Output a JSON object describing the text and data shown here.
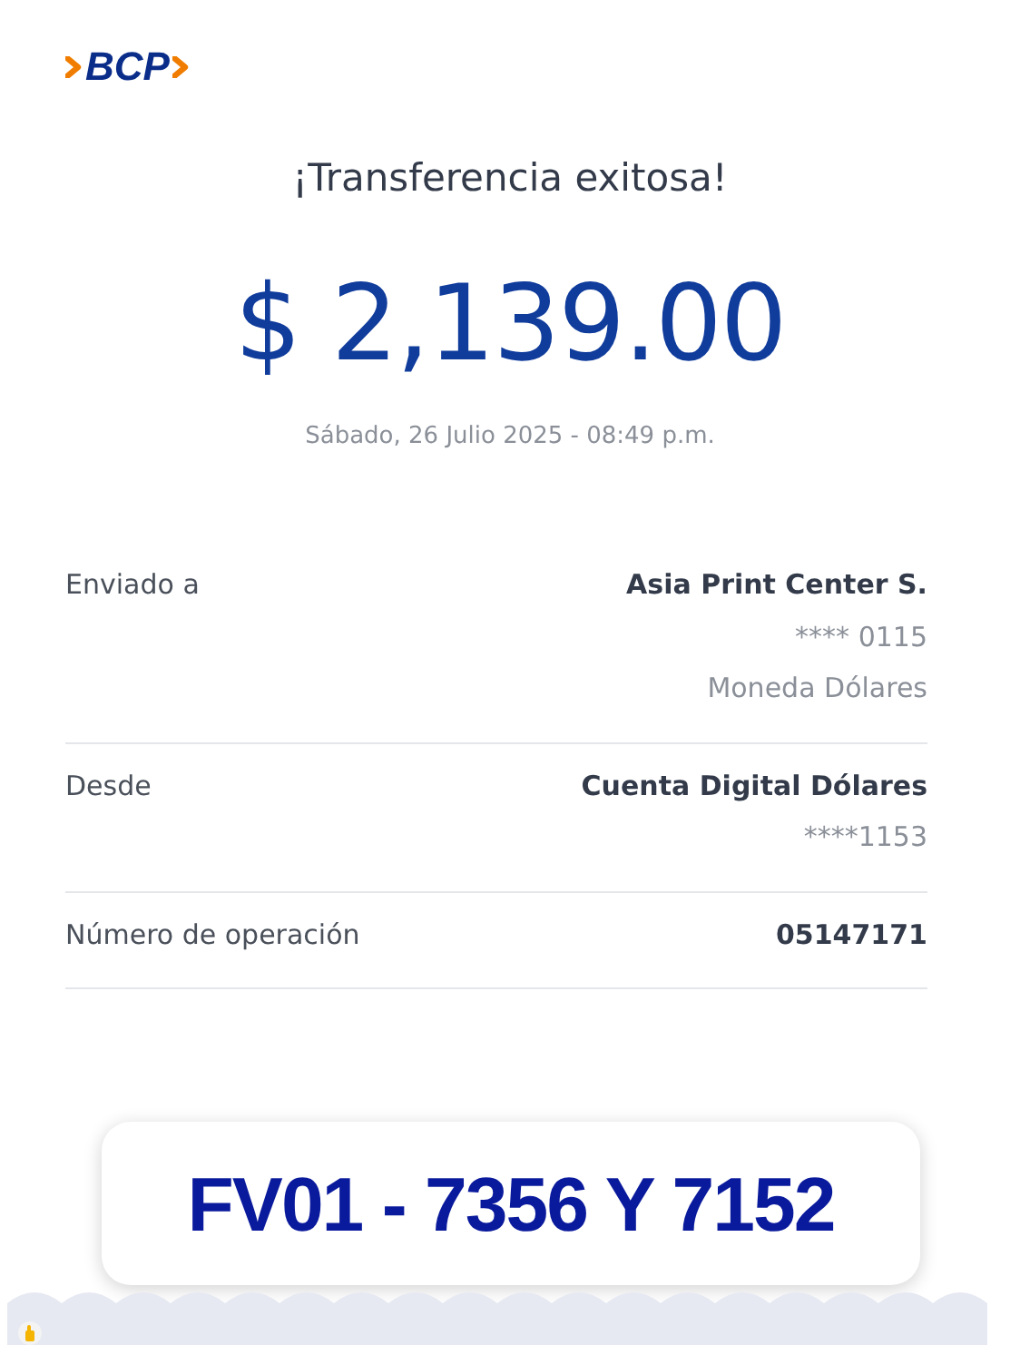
{
  "logo": {
    "text": "BCP"
  },
  "title": "¡Transferencia exitosa!",
  "amount": "$ 2,139.00",
  "date": "Sábado, 26 Julio 2025 - 08:49 p.m.",
  "details": [
    {
      "label": "Enviado a",
      "values": [
        {
          "text": "Asia Print Center S.",
          "kind": "primary"
        },
        {
          "text": "**** 0115",
          "kind": "secondary"
        },
        {
          "text": "Moneda Dólares",
          "kind": "secondary"
        }
      ]
    },
    {
      "label": "Desde",
      "values": [
        {
          "text": "Cuenta Digital Dólares",
          "kind": "primary"
        },
        {
          "text": "****1153",
          "kind": "secondary"
        }
      ]
    },
    {
      "label": "Número de operación",
      "values": [
        {
          "text": "05147171",
          "kind": "primary"
        }
      ]
    }
  ],
  "note": "FV01 - 7356 Y 7152"
}
